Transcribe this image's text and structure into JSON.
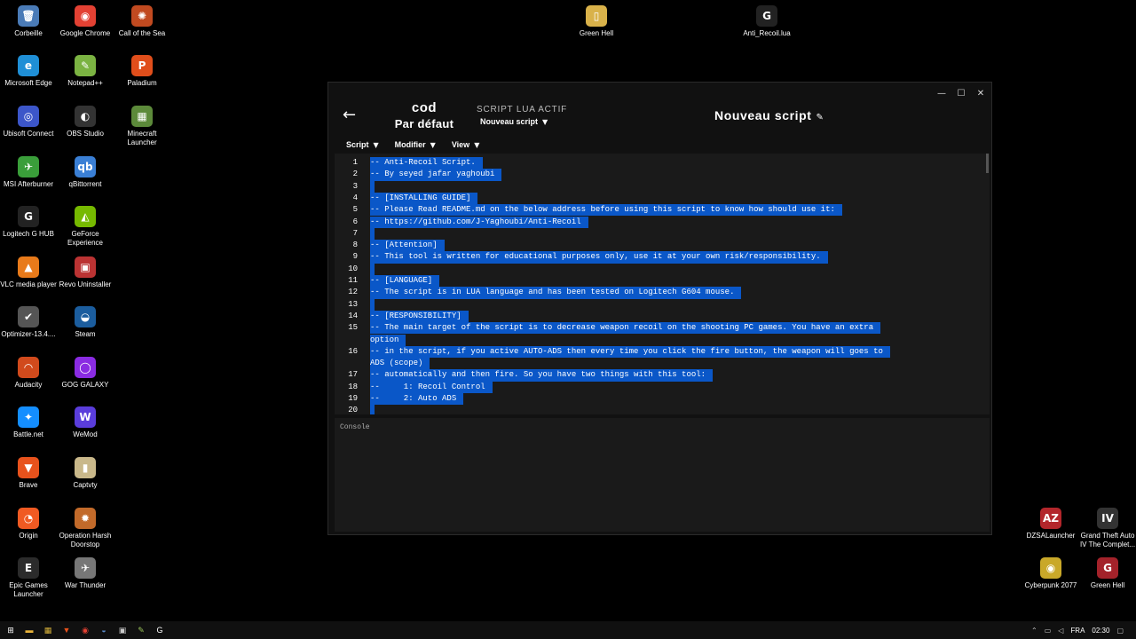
{
  "desktop_icons": [
    {
      "label": "Corbeille",
      "icon": "recycle-bin-icon",
      "glyph": "🗑",
      "color": "#4a7bb7"
    },
    {
      "label": "Google Chrome",
      "icon": "chrome-icon",
      "glyph": "◉",
      "color": "#e34133"
    },
    {
      "label": "Call of the Sea",
      "icon": "call-of-the-sea-icon",
      "glyph": "✺",
      "color": "#c14a20"
    },
    {
      "label": "Microsoft Edge",
      "icon": "edge-icon",
      "glyph": "e",
      "color": "#1f8fd6"
    },
    {
      "label": "Notepad++",
      "icon": "notepad-plus-plus-icon",
      "glyph": "✎",
      "color": "#7bb342"
    },
    {
      "label": "Paladium",
      "icon": "paladium-icon",
      "glyph": "P",
      "color": "#e04e1b"
    },
    {
      "label": "Ubisoft Connect",
      "icon": "ubisoft-icon",
      "glyph": "◎",
      "color": "#3c56c9"
    },
    {
      "label": "OBS Studio",
      "icon": "obs-icon",
      "glyph": "◐",
      "color": "#333"
    },
    {
      "label": "Minecraft Launcher",
      "icon": "minecraft-icon",
      "glyph": "▦",
      "color": "#5c8a3a"
    },
    {
      "label": "MSI Afterburner",
      "icon": "afterburner-icon",
      "glyph": "✈",
      "color": "#3a9e3a"
    },
    {
      "label": "qBittorrent",
      "icon": "qbittorrent-icon",
      "glyph": "qb",
      "color": "#3a7fd5"
    },
    {
      "label": "Logitech G HUB",
      "icon": "logitech-g-hub-icon",
      "glyph": "G",
      "color": "#222"
    },
    {
      "label": "GeForce Experience",
      "icon": "geforce-icon",
      "glyph": "◭",
      "color": "#76b900"
    },
    {
      "label": "VLC media player",
      "icon": "vlc-icon",
      "glyph": "▲",
      "color": "#e87a1a"
    },
    {
      "label": "Revo Uninstaller",
      "icon": "revo-uninstaller-icon",
      "glyph": "▣",
      "color": "#b33"
    },
    {
      "label": "Optimizer-13.4....",
      "icon": "optimizer-icon",
      "glyph": "✔",
      "color": "#555"
    },
    {
      "label": "Steam",
      "icon": "steam-icon",
      "glyph": "◒",
      "color": "#1b5d9e"
    },
    {
      "label": "Audacity",
      "icon": "audacity-icon",
      "glyph": "◠",
      "color": "#d14a1c"
    },
    {
      "label": "GOG GALAXY",
      "icon": "gog-galaxy-icon",
      "glyph": "◯",
      "color": "#8a2be2"
    },
    {
      "label": "Battle.net",
      "icon": "battle-net-icon",
      "glyph": "✦",
      "color": "#148eff"
    },
    {
      "label": "WeMod",
      "icon": "wemod-icon",
      "glyph": "W",
      "color": "#5a3ddb"
    },
    {
      "label": "Brave",
      "icon": "brave-icon",
      "glyph": "▼",
      "color": "#e8521c"
    },
    {
      "label": "Captvty",
      "icon": "captvty-icon",
      "glyph": "▮",
      "color": "#c9b88a"
    },
    {
      "label": "Origin",
      "icon": "origin-icon",
      "glyph": "◔",
      "color": "#f05a22"
    },
    {
      "label": "Operation Harsh Doorstop",
      "icon": "operation-harsh-doorstop-icon",
      "glyph": "✹",
      "color": "#c26a2a"
    },
    {
      "label": "Epic Games Launcher",
      "icon": "epic-games-icon",
      "glyph": "E",
      "color": "#2b2b2b"
    },
    {
      "label": "War Thunder",
      "icon": "war-thunder-icon",
      "glyph": "✈",
      "color": "#777"
    },
    {
      "label": "Green Hell",
      "icon": "green-hell-shortcut-icon",
      "glyph": "▯",
      "color": "#d9b24a"
    },
    {
      "label": "Anti_Recoil.lua",
      "icon": "lua-file-icon",
      "glyph": "G",
      "color": "#222"
    },
    {
      "label": "DZSALauncher",
      "icon": "dzsa-launcher-icon",
      "glyph": "AZ",
      "color": "#b3262b"
    },
    {
      "label": "Grand Theft Auto IV The Complet...",
      "icon": "gta-iv-icon",
      "glyph": "IV",
      "color": "#333"
    },
    {
      "label": "Cyberpunk 2077",
      "icon": "cyberpunk-icon",
      "glyph": "◉",
      "color": "#c9a829"
    },
    {
      "label": "Green Hell",
      "icon": "green-hell-icon",
      "glyph": "G",
      "color": "#a3222a"
    }
  ],
  "window": {
    "back": "←",
    "controls": {
      "minimize": "—",
      "maximize": "☐",
      "close": "✕"
    },
    "profile_game": "cod",
    "profile_name": "Par défaut",
    "active_script_title": "SCRIPT LUA ACTIF",
    "active_script_value": "Nouveau script",
    "script_name": "Nouveau script",
    "menus": [
      "Script",
      "Modifier",
      "View"
    ],
    "console_label": "Console",
    "code_lines": [
      {
        "n": "1",
        "text": "-- Anti-Recoil Script."
      },
      {
        "n": "2",
        "text": "-- By seyed jafar yaghoubi"
      },
      {
        "n": "3",
        "text": ""
      },
      {
        "n": "4",
        "text": "-- [INSTALLING GUIDE]"
      },
      {
        "n": "5",
        "text": "-- Please Read README.md on the below address before using this script to know how should use it:"
      },
      {
        "n": "6",
        "text": "-- https://github.com/J-Yaghoubi/Anti-Recoil"
      },
      {
        "n": "7",
        "text": ""
      },
      {
        "n": "8",
        "text": "-- [Attention]"
      },
      {
        "n": "9",
        "text": "-- This tool is written for educational purposes only, use it at your own risk/responsibility."
      },
      {
        "n": "10",
        "text": ""
      },
      {
        "n": "11",
        "text": "-- [LANGUAGE]"
      },
      {
        "n": "12",
        "text": "-- The script is in LUA language and has been tested on Logitech G604 mouse."
      },
      {
        "n": "13",
        "text": ""
      },
      {
        "n": "14",
        "text": "-- [RESPONSIBILITY]"
      },
      {
        "n": "15",
        "text": "-- The main target of the script is to decrease weapon recoil on the shooting PC games. You have an extra",
        "wrap": "option"
      },
      {
        "n": "16",
        "text": "-- in the script, if you active AUTO-ADS then every time you click the fire button, the weapon will goes to",
        "wrap": "ADS (scope)"
      },
      {
        "n": "17",
        "text": "-- automatically and then fire. So you have two things with this tool:"
      },
      {
        "n": "18",
        "text": "--     1: Recoil Control"
      },
      {
        "n": "19",
        "text": "--     2: Auto ADS"
      },
      {
        "n": "20",
        "text": ""
      }
    ]
  },
  "taskbar": {
    "items": [
      {
        "icon": "start-icon",
        "glyph": "⊞",
        "color": "#fff"
      },
      {
        "icon": "file-explorer-icon",
        "glyph": "▬",
        "color": "#e8b33a"
      },
      {
        "icon": "calendar-app-icon",
        "glyph": "▦",
        "color": "#d6b13a"
      },
      {
        "icon": "brave-taskbar-icon",
        "glyph": "▼",
        "color": "#e8521c"
      },
      {
        "icon": "chrome-taskbar-icon",
        "glyph": "◉",
        "color": "#e34133"
      },
      {
        "icon": "steam-taskbar-icon",
        "glyph": "◒",
        "color": "#5a8ac6"
      },
      {
        "icon": "terminal-taskbar-icon",
        "glyph": "▣",
        "color": "#ccc"
      },
      {
        "icon": "notepad-plus-plus-taskbar-icon",
        "glyph": "✎",
        "color": "#9cc55a"
      },
      {
        "icon": "g-hub-taskbar-icon",
        "glyph": "G",
        "color": "#fff"
      }
    ],
    "language": "FRA",
    "time": "02:30"
  }
}
